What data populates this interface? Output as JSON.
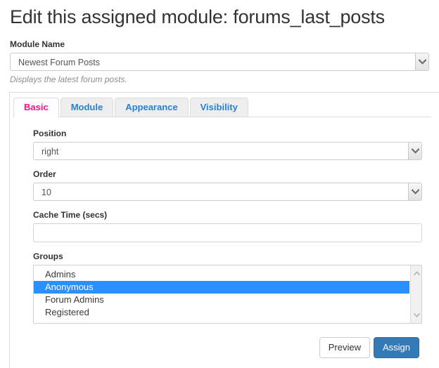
{
  "page": {
    "title": "Edit this assigned module: forums_last_posts"
  },
  "module_name": {
    "label": "Module Name",
    "selected": "Newest Forum Posts",
    "options": [
      "Newest Forum Posts"
    ],
    "help": "Displays the latest forum posts."
  },
  "tabs": [
    {
      "label": "Basic",
      "active": true
    },
    {
      "label": "Module",
      "active": false
    },
    {
      "label": "Appearance",
      "active": false
    },
    {
      "label": "Visibility",
      "active": false
    }
  ],
  "fields": {
    "position": {
      "label": "Position",
      "selected": "right",
      "options": [
        "right"
      ]
    },
    "order": {
      "label": "Order",
      "selected": "10",
      "options": [
        "10"
      ]
    },
    "cache_time": {
      "label": "Cache Time (secs)",
      "value": "",
      "placeholder": ""
    },
    "groups": {
      "label": "Groups",
      "items": [
        {
          "label": "Admins",
          "selected": false
        },
        {
          "label": "Anonymous",
          "selected": true
        },
        {
          "label": "Forum Admins",
          "selected": false
        },
        {
          "label": "Registered",
          "selected": false
        }
      ]
    }
  },
  "footer": {
    "preview_label": "Preview",
    "assign_label": "Assign"
  },
  "colors": {
    "active_tab": "#ff0f84",
    "tab_link": "#2a7fd4",
    "primary_button": "#337ab7",
    "selection": "#2a90ff"
  }
}
